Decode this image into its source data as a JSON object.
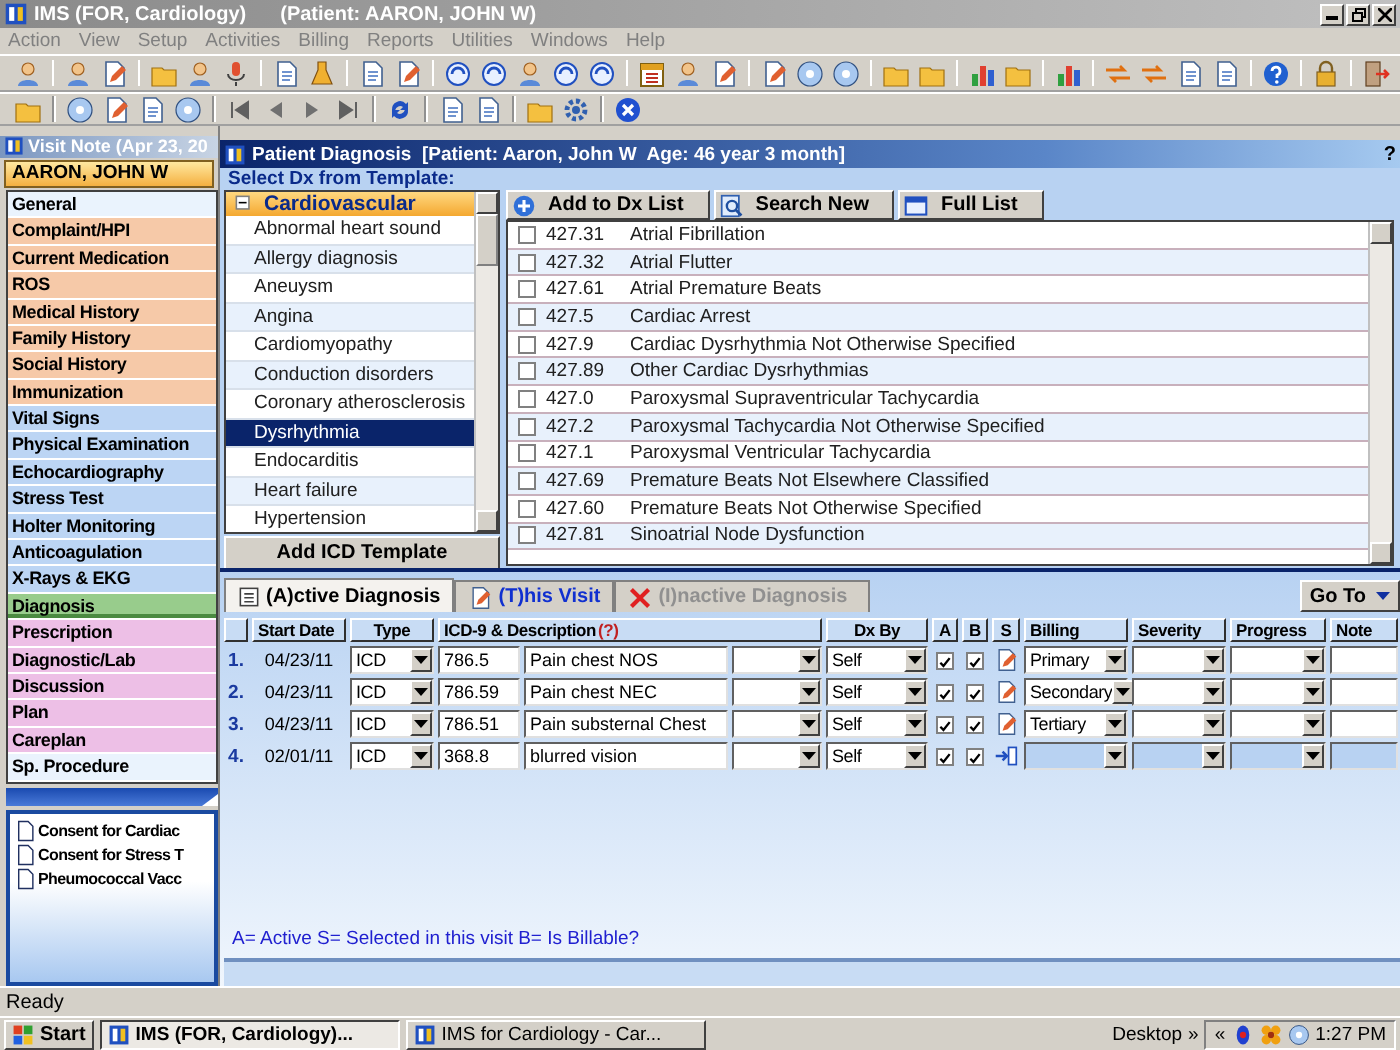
{
  "window": {
    "title": "IMS (FOR, Cardiology)",
    "patient": "(Patient: AARON, JOHN W)"
  },
  "menu": [
    "Action",
    "View",
    "Setup",
    "Activities",
    "Billing",
    "Reports",
    "Utilities",
    "Windows",
    "Help"
  ],
  "visit_note": {
    "title": "Visit Note (Apr 23, 20",
    "patient": "AARON, JOHN W",
    "sections": [
      {
        "label": "General",
        "color": "#eaf3fd",
        "selected": false
      },
      {
        "label": "Complaint/HPI",
        "color": "#f6c9a8",
        "selected": false
      },
      {
        "label": "Current Medication",
        "color": "#f6c9a8",
        "selected": false
      },
      {
        "label": "ROS",
        "color": "#f6c9a8",
        "selected": false
      },
      {
        "label": "Medical History",
        "color": "#f6c9a8",
        "selected": false
      },
      {
        "label": "Family History",
        "color": "#f6c9a8",
        "selected": false
      },
      {
        "label": "Social History",
        "color": "#f6c9a8",
        "selected": false
      },
      {
        "label": "Immunization",
        "color": "#f6c9a8",
        "selected": false
      },
      {
        "label": "Vital Signs",
        "color": "#bcd5f4",
        "selected": false
      },
      {
        "label": "Physical Examination",
        "color": "#bcd5f4",
        "selected": false
      },
      {
        "label": "Echocardiography",
        "color": "#bcd5f4",
        "selected": false
      },
      {
        "label": "Stress Test",
        "color": "#bcd5f4",
        "selected": false
      },
      {
        "label": "Holter Monitoring",
        "color": "#bcd5f4",
        "selected": false
      },
      {
        "label": "Anticoagulation",
        "color": "#bcd5f4",
        "selected": false
      },
      {
        "label": "X-Rays & EKG",
        "color": "#bcd5f4",
        "selected": false
      },
      {
        "label": "Diagnosis",
        "color": "#98cc8c",
        "selected": true
      },
      {
        "label": "Prescription",
        "color": "#edbfe6",
        "selected": false
      },
      {
        "label": "Diagnostic/Lab",
        "color": "#edbfe6",
        "selected": false
      },
      {
        "label": "Discussion",
        "color": "#edbfe6",
        "selected": false
      },
      {
        "label": "Plan",
        "color": "#edbfe6",
        "selected": false
      },
      {
        "label": "Careplan",
        "color": "#edbfe6",
        "selected": false
      },
      {
        "label": "Sp. Procedure",
        "color": "#eaf3fd",
        "selected": false
      }
    ],
    "documents": [
      "Consent for Cardiac",
      "Consent for Stress T",
      "Pheumococcal Vacc"
    ]
  },
  "dialog": {
    "title": "Patient Diagnosis  [Patient: Aaron, John W  Age: 46 year 3 month]",
    "help": "?",
    "template_label": "Select Dx from Template:",
    "template": {
      "category": "Cardiovascular",
      "expanded": true,
      "items": [
        {
          "label": "Abnormal heart sound",
          "selected": false
        },
        {
          "label": "Allergy diagnosis",
          "selected": false
        },
        {
          "label": "Aneuysm",
          "selected": false
        },
        {
          "label": "Angina",
          "selected": false
        },
        {
          "label": "Cardiomyopathy",
          "selected": false
        },
        {
          "label": "Conduction disorders",
          "selected": false
        },
        {
          "label": "Coronary atherosclerosis",
          "selected": false
        },
        {
          "label": "Dysrhythmia",
          "selected": true
        },
        {
          "label": "Endocarditis",
          "selected": false
        },
        {
          "label": "Heart failure",
          "selected": false
        },
        {
          "label": "Hypertension",
          "selected": false
        }
      ]
    },
    "add_template_button": "Add ICD Template",
    "buttons": [
      {
        "label": "Add to Dx List",
        "kind": "add"
      },
      {
        "label": "Search New",
        "kind": "search"
      },
      {
        "label": "Full List",
        "kind": "list"
      }
    ],
    "codes": [
      {
        "code": "427.31",
        "description": "Atrial Fibrillation",
        "checked": false
      },
      {
        "code": "427.32",
        "description": "Atrial Flutter",
        "checked": false
      },
      {
        "code": "427.61",
        "description": "Atrial Premature Beats",
        "checked": false
      },
      {
        "code": "427.5",
        "description": "Cardiac Arrest",
        "checked": false
      },
      {
        "code": "427.9",
        "description": "Cardiac Dysrhythmia Not Otherwise Specified",
        "checked": false
      },
      {
        "code": "427.89",
        "description": "Other Cardiac Dysrhythmias",
        "checked": false
      },
      {
        "code": "427.0",
        "description": "Paroxysmal Supraventricular Tachycardia",
        "checked": false
      },
      {
        "code": "427.2",
        "description": "Paroxysmal Tachycardia Not Otherwise Specified",
        "checked": false
      },
      {
        "code": "427.1",
        "description": "Paroxysmal Ventricular Tachycardia",
        "checked": false
      },
      {
        "code": "427.69",
        "description": "Premature Beats Not Elsewhere Classified",
        "checked": false
      },
      {
        "code": "427.60",
        "description": "Premature Beats Not Otherwise Specified",
        "checked": false
      },
      {
        "code": "427.81",
        "description": "Sinoatrial Node Dysfunction",
        "checked": false
      }
    ],
    "tabs": [
      {
        "label": "(A)ctive Diagnosis",
        "kind": "active",
        "selected": true
      },
      {
        "label": "(T)his Visit",
        "kind": "visit",
        "selected": false
      },
      {
        "label": "(I)nactive Diagnosis",
        "kind": "inactive",
        "selected": false
      }
    ],
    "goto_button": "Go To",
    "columns": {
      "start_date": "Start Date",
      "type": "Type",
      "description": "ICD-9  & Description",
      "help": "(?)",
      "dx_by": "Dx By",
      "active": "A",
      "billable": "B",
      "selected": "S",
      "billing": "Billing",
      "severity": "Severity",
      "progress": "Progress",
      "note": "Note"
    },
    "rows": [
      {
        "number": "1.",
        "start_date": "04/23/11",
        "type": "ICD",
        "code": "786.5",
        "description": "Pain  chest NOS",
        "dx_by": "Self",
        "active": true,
        "billable": true,
        "kind": "note",
        "billing": "Primary",
        "disabled": false
      },
      {
        "number": "2.",
        "start_date": "04/23/11",
        "type": "ICD",
        "code": "786.59",
        "description": "Pain  chest NEC",
        "dx_by": "Self",
        "active": true,
        "billable": true,
        "kind": "note",
        "billing": "Secondary",
        "disabled": false
      },
      {
        "number": "3.",
        "start_date": "04/23/11",
        "type": "ICD",
        "code": "786.51",
        "description": "Pain  substernal Chest",
        "dx_by": "Self",
        "active": true,
        "billable": true,
        "kind": "note",
        "billing": "Tertiary",
        "disabled": false
      },
      {
        "number": "4.",
        "start_date": "02/01/11",
        "type": "ICD",
        "code": "368.8",
        "description": "blurred vision",
        "dx_by": "Self",
        "active": true,
        "billable": true,
        "kind": "transfer",
        "disabled": true
      }
    ],
    "legend": "A= Active  S= Selected in this visit   B= Is Billable?"
  },
  "status_bar": "Ready",
  "taskbar": {
    "start": "Start",
    "tasks": [
      {
        "label": "IMS (FOR, Cardiology)...",
        "selected": true
      },
      {
        "label": "IMS for Cardiology - Car...",
        "selected": false
      }
    ],
    "desktop": "Desktop",
    "more": "»",
    "collapse": "«",
    "clock": "1:27 PM"
  }
}
